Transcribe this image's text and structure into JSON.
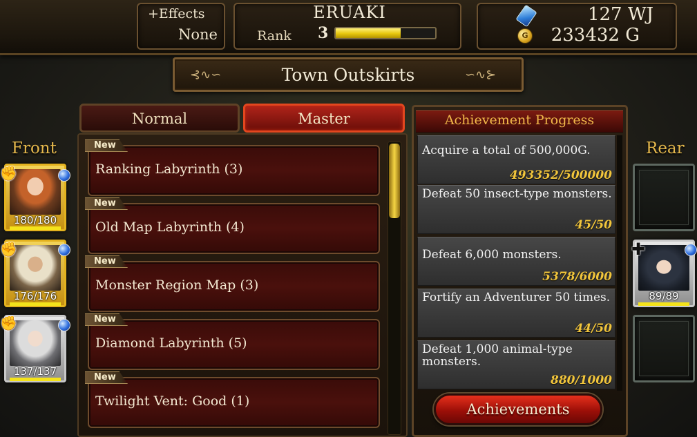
{
  "header": {
    "effects_label": "+Effects",
    "effects_value": "None",
    "player_name": "ERUAKI",
    "rank_label": "Rank",
    "rank_value": "3",
    "rank_progress": 0.65,
    "wj_amount": "127 WJ",
    "gold_amount": "233432 G",
    "gold_coin_glyph": "G"
  },
  "location": {
    "title": "Town Outskirts"
  },
  "party": {
    "front_label": "Front",
    "rear_label": "Rear",
    "front": [
      {
        "hp": "180/180",
        "hp_fraction": 1.0
      },
      {
        "hp": "176/176",
        "hp_fraction": 1.0
      },
      {
        "hp": "137/137",
        "hp_fraction": 1.0
      }
    ],
    "rear": [
      {
        "empty": true
      },
      {
        "hp": "89/89",
        "hp_fraction": 1.0
      },
      {
        "empty": true
      }
    ]
  },
  "tabs": {
    "normal": "Normal",
    "master": "Master",
    "selected": "Master"
  },
  "labyrinths": {
    "new_label": "New",
    "items": [
      {
        "label": "Ranking Labyrinth (3)"
      },
      {
        "label": "Old Map Labyrinth (4)"
      },
      {
        "label": "Monster Region Map (3)"
      },
      {
        "label": "Diamond Labyrinth (5)"
      },
      {
        "label": "Twilight Vent: Good (1)"
      }
    ]
  },
  "achievements": {
    "title": "Achievement Progress",
    "button": "Achievements",
    "items": [
      {
        "text": "Acquire a total of 500,000G.",
        "progress": "493352/500000"
      },
      {
        "text": "Defeat 50 insect-type monsters.",
        "progress": "45/50"
      },
      {
        "text": "Defeat 6,000 monsters.",
        "progress": "5378/6000"
      },
      {
        "text": "Fortify an Adventurer 50 times.",
        "progress": "44/50"
      },
      {
        "text": "Defeat 1,000 animal-type monsters.",
        "progress": "880/1000"
      }
    ]
  },
  "colors": {
    "gold_accent": "#e5b84c",
    "rank_bar": "#e7c70e",
    "master_tab": "#b0241a",
    "progress_text": "#f1c53c"
  },
  "icons": {
    "wj": "blue-crystal-icon",
    "gold": "gold-coin-icon",
    "class_badge": "gauntlet-icon",
    "orb": "blue-orb-icon",
    "add_ally": "plus-cross-icon"
  }
}
